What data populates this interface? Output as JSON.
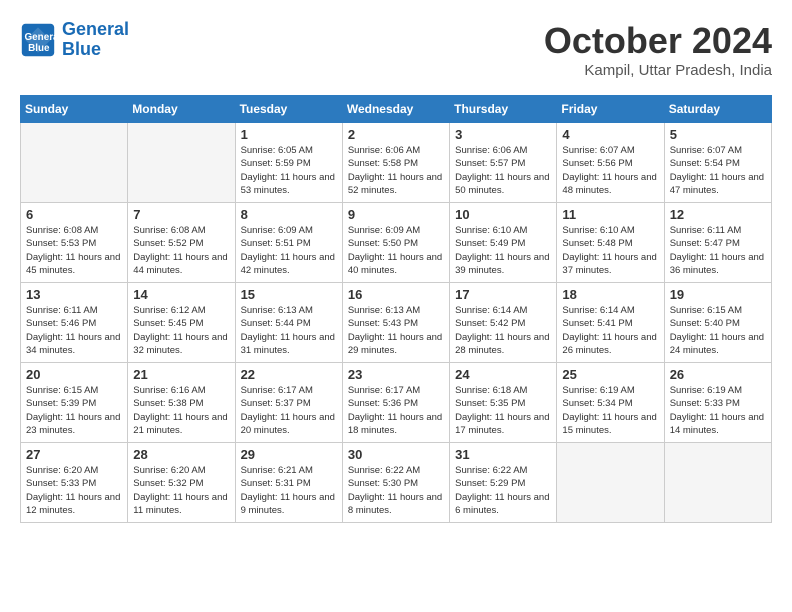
{
  "header": {
    "logo_line1": "General",
    "logo_line2": "Blue",
    "month": "October 2024",
    "location": "Kampil, Uttar Pradesh, India"
  },
  "days_of_week": [
    "Sunday",
    "Monday",
    "Tuesday",
    "Wednesday",
    "Thursday",
    "Friday",
    "Saturday"
  ],
  "weeks": [
    [
      {
        "day": "",
        "empty": true
      },
      {
        "day": "",
        "empty": true
      },
      {
        "day": "1",
        "sunrise": "Sunrise: 6:05 AM",
        "sunset": "Sunset: 5:59 PM",
        "daylight": "Daylight: 11 hours and 53 minutes."
      },
      {
        "day": "2",
        "sunrise": "Sunrise: 6:06 AM",
        "sunset": "Sunset: 5:58 PM",
        "daylight": "Daylight: 11 hours and 52 minutes."
      },
      {
        "day": "3",
        "sunrise": "Sunrise: 6:06 AM",
        "sunset": "Sunset: 5:57 PM",
        "daylight": "Daylight: 11 hours and 50 minutes."
      },
      {
        "day": "4",
        "sunrise": "Sunrise: 6:07 AM",
        "sunset": "Sunset: 5:56 PM",
        "daylight": "Daylight: 11 hours and 48 minutes."
      },
      {
        "day": "5",
        "sunrise": "Sunrise: 6:07 AM",
        "sunset": "Sunset: 5:54 PM",
        "daylight": "Daylight: 11 hours and 47 minutes."
      }
    ],
    [
      {
        "day": "6",
        "sunrise": "Sunrise: 6:08 AM",
        "sunset": "Sunset: 5:53 PM",
        "daylight": "Daylight: 11 hours and 45 minutes."
      },
      {
        "day": "7",
        "sunrise": "Sunrise: 6:08 AM",
        "sunset": "Sunset: 5:52 PM",
        "daylight": "Daylight: 11 hours and 44 minutes."
      },
      {
        "day": "8",
        "sunrise": "Sunrise: 6:09 AM",
        "sunset": "Sunset: 5:51 PM",
        "daylight": "Daylight: 11 hours and 42 minutes."
      },
      {
        "day": "9",
        "sunrise": "Sunrise: 6:09 AM",
        "sunset": "Sunset: 5:50 PM",
        "daylight": "Daylight: 11 hours and 40 minutes."
      },
      {
        "day": "10",
        "sunrise": "Sunrise: 6:10 AM",
        "sunset": "Sunset: 5:49 PM",
        "daylight": "Daylight: 11 hours and 39 minutes."
      },
      {
        "day": "11",
        "sunrise": "Sunrise: 6:10 AM",
        "sunset": "Sunset: 5:48 PM",
        "daylight": "Daylight: 11 hours and 37 minutes."
      },
      {
        "day": "12",
        "sunrise": "Sunrise: 6:11 AM",
        "sunset": "Sunset: 5:47 PM",
        "daylight": "Daylight: 11 hours and 36 minutes."
      }
    ],
    [
      {
        "day": "13",
        "sunrise": "Sunrise: 6:11 AM",
        "sunset": "Sunset: 5:46 PM",
        "daylight": "Daylight: 11 hours and 34 minutes."
      },
      {
        "day": "14",
        "sunrise": "Sunrise: 6:12 AM",
        "sunset": "Sunset: 5:45 PM",
        "daylight": "Daylight: 11 hours and 32 minutes."
      },
      {
        "day": "15",
        "sunrise": "Sunrise: 6:13 AM",
        "sunset": "Sunset: 5:44 PM",
        "daylight": "Daylight: 11 hours and 31 minutes."
      },
      {
        "day": "16",
        "sunrise": "Sunrise: 6:13 AM",
        "sunset": "Sunset: 5:43 PM",
        "daylight": "Daylight: 11 hours and 29 minutes."
      },
      {
        "day": "17",
        "sunrise": "Sunrise: 6:14 AM",
        "sunset": "Sunset: 5:42 PM",
        "daylight": "Daylight: 11 hours and 28 minutes."
      },
      {
        "day": "18",
        "sunrise": "Sunrise: 6:14 AM",
        "sunset": "Sunset: 5:41 PM",
        "daylight": "Daylight: 11 hours and 26 minutes."
      },
      {
        "day": "19",
        "sunrise": "Sunrise: 6:15 AM",
        "sunset": "Sunset: 5:40 PM",
        "daylight": "Daylight: 11 hours and 24 minutes."
      }
    ],
    [
      {
        "day": "20",
        "sunrise": "Sunrise: 6:15 AM",
        "sunset": "Sunset: 5:39 PM",
        "daylight": "Daylight: 11 hours and 23 minutes."
      },
      {
        "day": "21",
        "sunrise": "Sunrise: 6:16 AM",
        "sunset": "Sunset: 5:38 PM",
        "daylight": "Daylight: 11 hours and 21 minutes."
      },
      {
        "day": "22",
        "sunrise": "Sunrise: 6:17 AM",
        "sunset": "Sunset: 5:37 PM",
        "daylight": "Daylight: 11 hours and 20 minutes."
      },
      {
        "day": "23",
        "sunrise": "Sunrise: 6:17 AM",
        "sunset": "Sunset: 5:36 PM",
        "daylight": "Daylight: 11 hours and 18 minutes."
      },
      {
        "day": "24",
        "sunrise": "Sunrise: 6:18 AM",
        "sunset": "Sunset: 5:35 PM",
        "daylight": "Daylight: 11 hours and 17 minutes."
      },
      {
        "day": "25",
        "sunrise": "Sunrise: 6:19 AM",
        "sunset": "Sunset: 5:34 PM",
        "daylight": "Daylight: 11 hours and 15 minutes."
      },
      {
        "day": "26",
        "sunrise": "Sunrise: 6:19 AM",
        "sunset": "Sunset: 5:33 PM",
        "daylight": "Daylight: 11 hours and 14 minutes."
      }
    ],
    [
      {
        "day": "27",
        "sunrise": "Sunrise: 6:20 AM",
        "sunset": "Sunset: 5:33 PM",
        "daylight": "Daylight: 11 hours and 12 minutes."
      },
      {
        "day": "28",
        "sunrise": "Sunrise: 6:20 AM",
        "sunset": "Sunset: 5:32 PM",
        "daylight": "Daylight: 11 hours and 11 minutes."
      },
      {
        "day": "29",
        "sunrise": "Sunrise: 6:21 AM",
        "sunset": "Sunset: 5:31 PM",
        "daylight": "Daylight: 11 hours and 9 minutes."
      },
      {
        "day": "30",
        "sunrise": "Sunrise: 6:22 AM",
        "sunset": "Sunset: 5:30 PM",
        "daylight": "Daylight: 11 hours and 8 minutes."
      },
      {
        "day": "31",
        "sunrise": "Sunrise: 6:22 AM",
        "sunset": "Sunset: 5:29 PM",
        "daylight": "Daylight: 11 hours and 6 minutes."
      },
      {
        "day": "",
        "empty": true
      },
      {
        "day": "",
        "empty": true
      }
    ]
  ]
}
